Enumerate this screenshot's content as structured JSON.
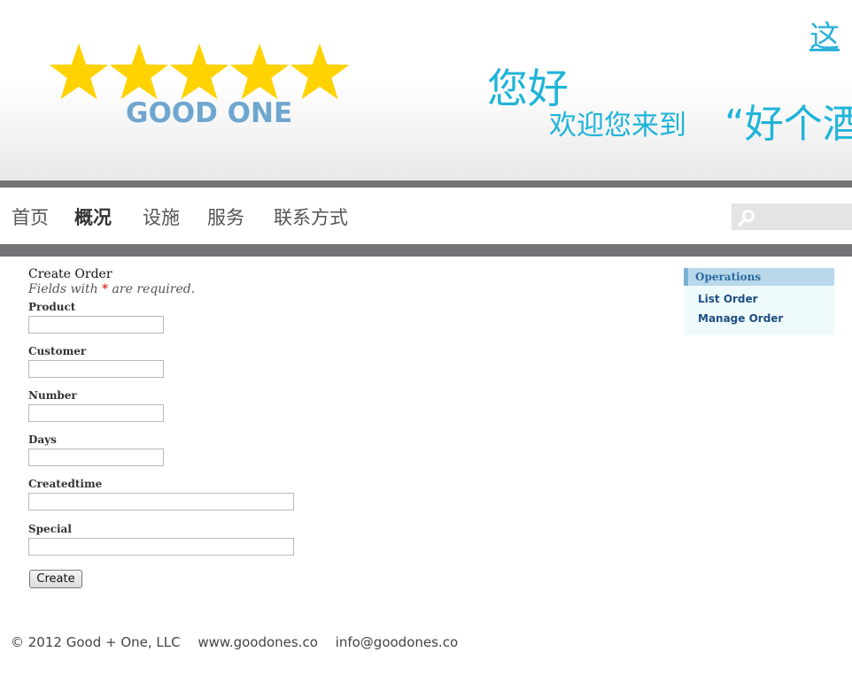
{
  "header": {
    "logo_text": "GOOD ONE",
    "greeting": "您好",
    "welcome": "欢迎您来到",
    "hotel_name": "“好个酒",
    "top_link": "这"
  },
  "nav": {
    "items": [
      {
        "label": "首页"
      },
      {
        "label": "概况"
      },
      {
        "label": "设施"
      },
      {
        "label": "服务"
      },
      {
        "label": "联系方式"
      }
    ],
    "search_value": ""
  },
  "form": {
    "title": "Create Order",
    "note_prefix": "Fields with ",
    "note_mark": "*",
    "note_suffix": " are required.",
    "fields": [
      {
        "label": "Product",
        "value": ""
      },
      {
        "label": "Customer",
        "value": ""
      },
      {
        "label": "Number",
        "value": ""
      },
      {
        "label": "Days",
        "value": ""
      },
      {
        "label": "Createdtime",
        "value": ""
      },
      {
        "label": "Special",
        "value": ""
      }
    ],
    "submit_label": "Create"
  },
  "operations": {
    "title": "Operations",
    "links": [
      {
        "label": "List Order"
      },
      {
        "label": "Manage Order"
      }
    ]
  },
  "footer": {
    "copyright": "© 2012 Good + One, LLC",
    "website": "www.goodones.co",
    "email": "info@goodones.co"
  },
  "colors": {
    "accent": "#1fb4d8",
    "logo": "#6ea6cf",
    "star": "#ffd200",
    "bar": "#747478"
  }
}
